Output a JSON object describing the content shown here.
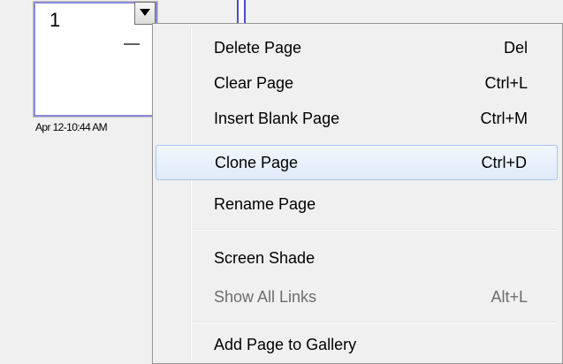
{
  "thumbnail": {
    "page_number": "1",
    "timestamp": "Apr 12-10:44 AM"
  },
  "icons": {
    "dropdown": "chevron-down-icon"
  },
  "colors": {
    "highlight_border": "#a7c5ee",
    "thumbnail_border": "#8a8ad8",
    "disabled_text": "#6d6d6d"
  },
  "context_menu": {
    "items": [
      {
        "label": "Delete Page",
        "shortcut": "Del",
        "enabled": true,
        "highlighted": false
      },
      {
        "label": "Clear Page",
        "shortcut": "Ctrl+L",
        "enabled": true,
        "highlighted": false
      },
      {
        "label": "Insert Blank Page",
        "shortcut": "Ctrl+M",
        "enabled": true,
        "highlighted": false
      },
      {
        "label": "Clone Page",
        "shortcut": "Ctrl+D",
        "enabled": true,
        "highlighted": true
      },
      {
        "label": "Rename Page",
        "shortcut": "",
        "enabled": true,
        "highlighted": false
      },
      {
        "label": "Screen Shade",
        "shortcut": "",
        "enabled": true,
        "highlighted": false
      },
      {
        "label": "Show All Links",
        "shortcut": "Alt+L",
        "enabled": false,
        "highlighted": false
      },
      {
        "label": "Add Page to Gallery",
        "shortcut": "",
        "enabled": true,
        "highlighted": false
      }
    ]
  }
}
